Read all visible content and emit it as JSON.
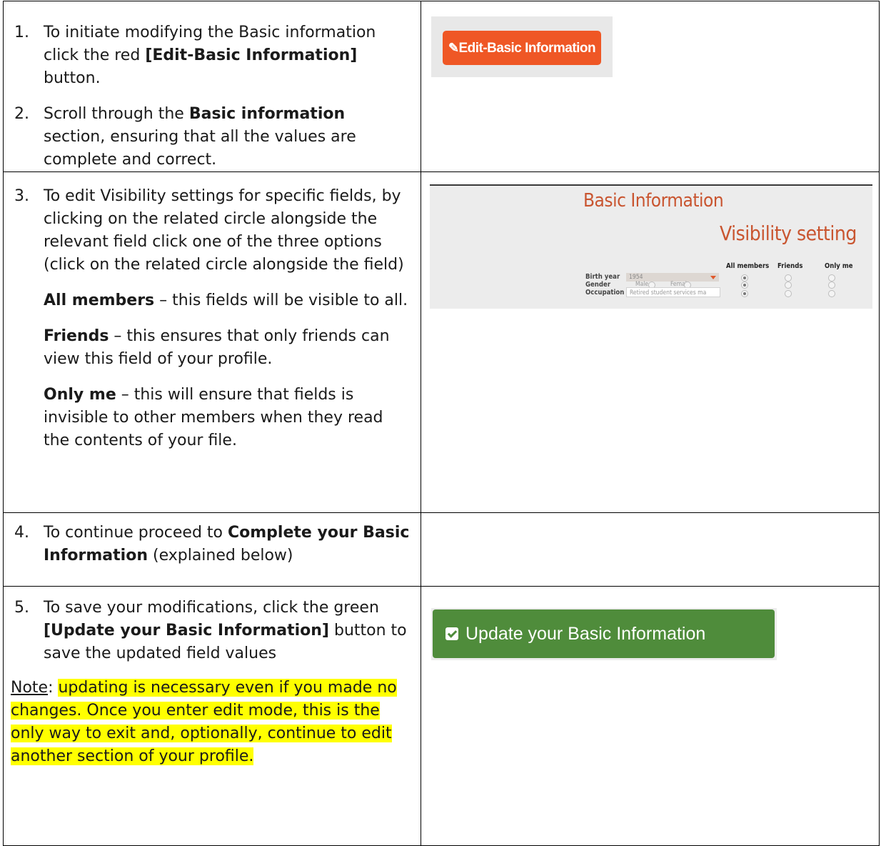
{
  "steps": {
    "s1": {
      "num": "1.",
      "text_before": "To initiate modifying the Basic information click the red ",
      "bold": "[Edit-Basic Information]",
      "text_after": " button."
    },
    "s2": {
      "num": "2.",
      "text_before": "Scroll through the ",
      "bold": "Basic information",
      "text_after": " section, ensuring that all the values are complete and correct."
    },
    "s3": {
      "num": "3.",
      "text": "To edit Visibility settings for specific fields, by clicking on the related circle alongside the relevant field click one of the three options (click on the related circle alongside the field)"
    },
    "opt_all": {
      "bold": "All members",
      "text": " – this fields will be visible to all."
    },
    "opt_friends": {
      "bold": "Friends",
      "text": " – this ensures that only friends can view this field of your profile."
    },
    "opt_me": {
      "bold": "Only me",
      "text": " – this will ensure that fields is invisible to other members when they read the contents of your file."
    },
    "s4": {
      "num": "4.",
      "text_before": "To continue proceed to ",
      "bold": "Complete your Basic Information",
      "text_after": " (explained below)"
    },
    "s5": {
      "num": "5.",
      "text_before": "To save your modifications, click the green ",
      "bold": "[Update your Basic Information]",
      "text_after": " button to save the updated field values"
    },
    "note": {
      "label": "Note",
      "colon": ": ",
      "text": "updating is necessary even if you made no changes.  Once you enter edit mode, this is the only way to exit and, optionally, continue to edit another section of your profile."
    }
  },
  "edit_button": {
    "label": "Edit-Basic Information",
    "icon": "pencil-icon",
    "color": "#ef5725"
  },
  "visibility_shot": {
    "title": "Basic Information",
    "subtitle": "Visibility setting",
    "columns": [
      "All members",
      "Friends",
      "Only me"
    ],
    "rows": [
      {
        "label": "Birth year",
        "value": "1954"
      },
      {
        "label": "Gender",
        "male": "Male",
        "female": "Female"
      },
      {
        "label": "Occupation",
        "value": "Retired student services ma"
      }
    ],
    "accent": "#c95530"
  },
  "update_button": {
    "label": "Update your Basic Information",
    "icon": "checkbox-icon",
    "color": "#4f8c3b"
  },
  "colors": {
    "highlight": "#ffff00"
  }
}
